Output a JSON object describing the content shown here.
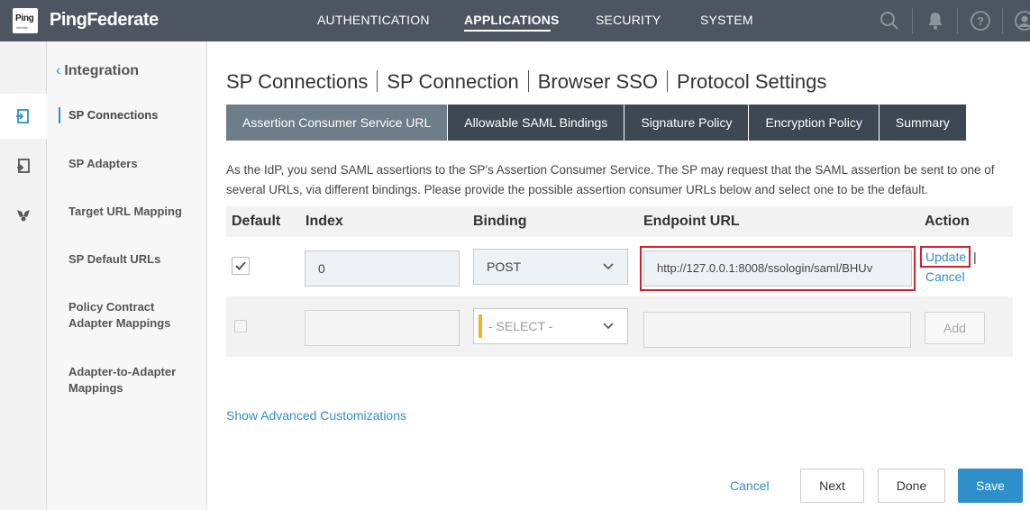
{
  "header": {
    "logo_text": "Ping",
    "logo_sub": "Identity",
    "brand": "PingFederate",
    "nav": [
      "AUTHENTICATION",
      "APPLICATIONS",
      "SECURITY",
      "SYSTEM"
    ],
    "active_nav": "APPLICATIONS",
    "icons": [
      "search-icon",
      "bell-icon",
      "help-icon",
      "user-icon"
    ]
  },
  "sidebar": {
    "back_label": "Integration",
    "items": [
      {
        "label": "SP Connections",
        "active": true
      },
      {
        "label": "SP Adapters"
      },
      {
        "label": "Target URL Mapping"
      },
      {
        "label": "SP Default URLs"
      },
      {
        "label": "Policy Contract Adapter Mappings"
      },
      {
        "label": "Adapter-to-Adapter Mappings"
      }
    ],
    "rail_icons": [
      "sp-connections-icon",
      "sp-adapters-icon",
      "target-mapping-icon"
    ]
  },
  "breadcrumb": [
    "SP Connections",
    "SP Connection",
    "Browser SSO",
    "Protocol Settings"
  ],
  "tabs": [
    {
      "label": "Assertion Consumer Service URL",
      "active": true
    },
    {
      "label": "Allowable SAML Bindings"
    },
    {
      "label": "Signature Policy"
    },
    {
      "label": "Encryption Policy"
    },
    {
      "label": "Summary"
    }
  ],
  "description": "As the IdP, you send SAML assertions to the SP's Assertion Consumer Service. The SP may request that the SAML assertion be sent to one of several URLs, via different bindings. Please provide the possible assertion consumer URLs below and select one to be the default.",
  "table": {
    "headers": {
      "default": "Default",
      "index": "Index",
      "binding": "Binding",
      "endpoint": "Endpoint URL",
      "action": "Action"
    },
    "edit_row": {
      "default_checked": true,
      "index": "0",
      "binding": "POST",
      "endpoint": "http://127.0.0.1:8008/ssologin/saml/BHUv",
      "update_label": "Update",
      "action_sep": "|",
      "cancel_label": "Cancel"
    },
    "new_row": {
      "binding_placeholder": "- SELECT -",
      "add_label": "Add"
    }
  },
  "advanced_link": "Show Advanced Customizations",
  "footer": {
    "cancel": "Cancel",
    "next": "Next",
    "done": "Done",
    "save": "Save"
  },
  "colors": {
    "header_bg": "#4d5660",
    "accent": "#2e8fca",
    "tab_bg": "#3e4852",
    "tab_active_bg": "#6e7d8a",
    "highlight": "#d0202e",
    "select_marker": "#f0b428"
  }
}
